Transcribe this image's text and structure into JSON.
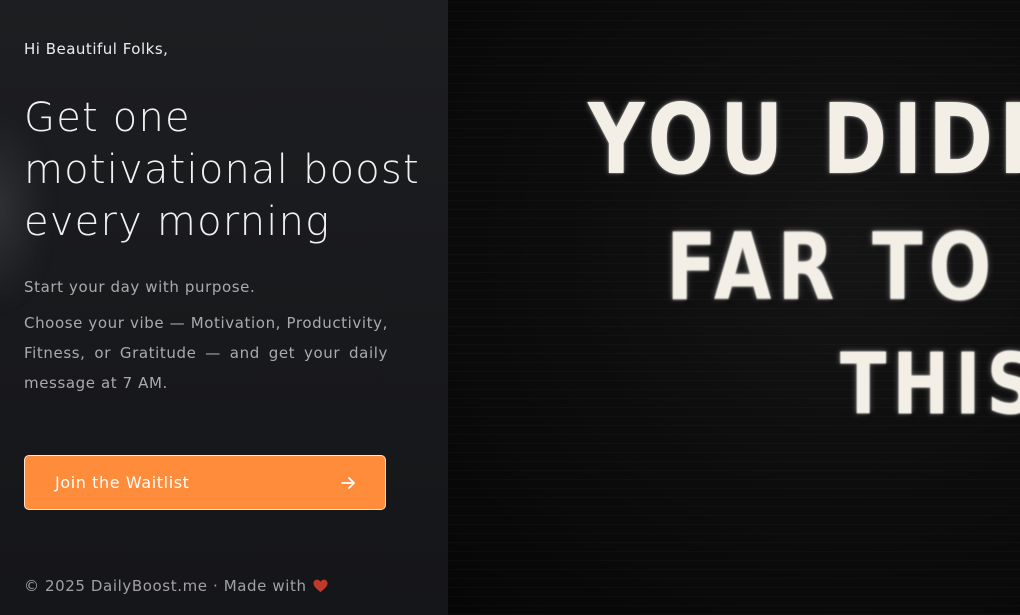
{
  "hero": {
    "greeting": "Hi Beautiful Folks,",
    "headline": "Get one motivational boost every morning",
    "tagline": "Start your day with purpose.",
    "description": "Choose your vibe — Motivation, Productivity, Fitness, or Gratitude — and get your daily message at 7 AM.",
    "cta_label": "Join the Waitlist",
    "cta_icon": "arrow-right-icon"
  },
  "footer": {
    "text": "© 2025 DailyBoost.me · Made with",
    "icon": "heart-icon"
  },
  "photo": {
    "sign_lines": [
      "YOU DIDNT",
      "FAR TO Q",
      "THIS"
    ]
  },
  "colors": {
    "accent": "#ff8c3a",
    "panel_bg": "#1b1c1f",
    "heart": "#c0392b"
  }
}
